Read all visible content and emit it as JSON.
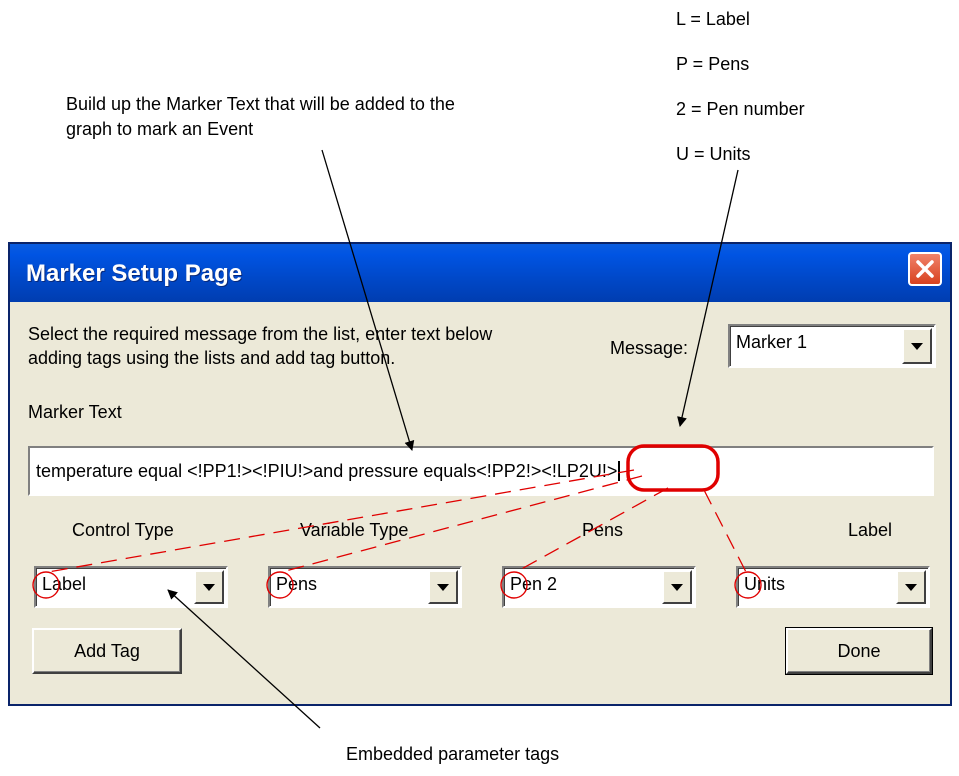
{
  "annotations": {
    "top_note_line1": "Build up the Marker Text that will be added to the",
    "top_note_line2": "graph to mark an Event",
    "bottom_note": "Embedded parameter tags",
    "legend": [
      "L = Label",
      "P = Pens",
      "2 = Pen number",
      "U = Units"
    ]
  },
  "dialog": {
    "title": "Marker Setup Page",
    "instruction_line1": "Select the required message from the list, enter text below",
    "instruction_line2": "adding tags using the lists and add tag button.",
    "message_label": "Message:",
    "message_value": "Marker 1",
    "marker_text_label": "Marker Text",
    "marker_text_value": "temperature equal <!PP1!><!PIU!>and pressure equals<!PP2!><!LP2U!>",
    "columns": {
      "control_type": {
        "label": "Control Type",
        "value": "Label"
      },
      "variable_type": {
        "label": "Variable Type",
        "value": "Pens"
      },
      "pens": {
        "label": "Pens",
        "value": "Pen 2"
      },
      "label": {
        "label": "Label",
        "value": "Units"
      }
    },
    "add_tag_button": "Add Tag",
    "done_button": "Done"
  },
  "colors": {
    "title_bar": "#0054e3",
    "dialog_bg": "#ece9d8",
    "highlight": "#e00000"
  }
}
